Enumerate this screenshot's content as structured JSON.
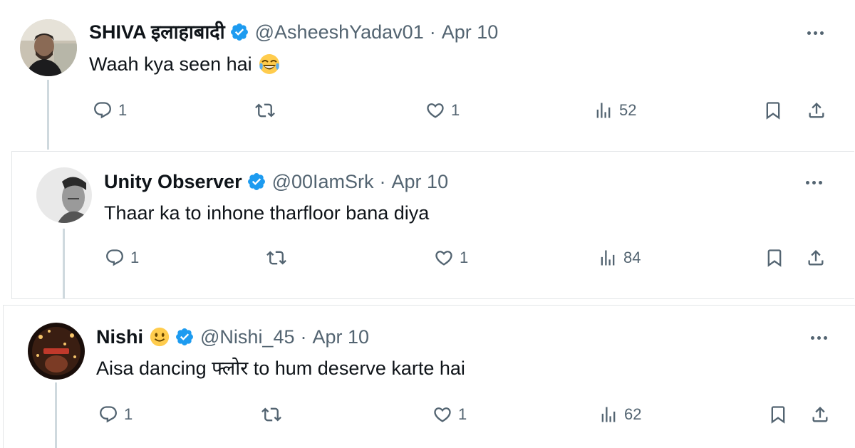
{
  "tweets": [
    {
      "name": "SHIVA इलाहाबादी",
      "handle": "@AsheeshYadav01",
      "separator": "·",
      "date": "Apr 10",
      "text": "Waah kya seen hai",
      "text_emoji": "😂",
      "replies": "1",
      "likes": "1",
      "views": "52"
    },
    {
      "name": "Unity Observer",
      "handle": "@00IamSrk",
      "separator": "·",
      "date": "Apr 10",
      "text": "Thaar ka to inhone tharfloor bana diya",
      "replies": "1",
      "likes": "1",
      "views": "84"
    },
    {
      "name": "Nishi",
      "name_emoji": "🙂",
      "handle": "@Nishi_45",
      "separator": "·",
      "date": "Apr 10",
      "text": "Aisa dancing फ्लोर to hum deserve karte hai",
      "replies": "1",
      "likes": "1",
      "views": "62"
    }
  ],
  "colors": {
    "text_primary": "#0f1419",
    "text_secondary": "#536471",
    "verified_blue": "#1d9bf0",
    "thread_line": "#cfd9de"
  },
  "icons": [
    "reply-icon",
    "retweet-icon",
    "like-icon",
    "views-icon",
    "bookmark-icon",
    "share-icon",
    "more-icon",
    "verified-badge-icon"
  ]
}
